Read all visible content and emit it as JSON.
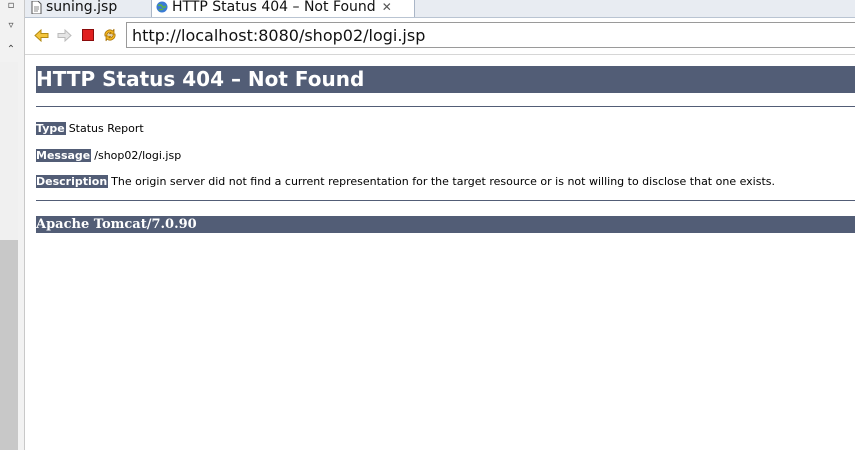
{
  "tabs": [
    {
      "label": "suning.jsp",
      "icon": "file-icon"
    },
    {
      "label": "HTTP Status 404 – Not Found",
      "icon": "globe-icon",
      "close": "✕"
    }
  ],
  "nav": {
    "back": "back-arrow-icon",
    "forward": "forward-arrow-icon",
    "stop": "stop-icon",
    "refresh": "refresh-icon",
    "url": "http://localhost:8080/shop02/logi.jsp"
  },
  "page": {
    "title": "HTTP Status 404 – Not Found",
    "type_label": "Type",
    "type_value": "Status Report",
    "message_label": "Message",
    "message_value": "/shop02/logi.jsp",
    "description_label": "Description",
    "description_value": "The origin server did not find a current representation for the target resource or is not willing to disclose that one exists.",
    "footer": "Apache Tomcat/7.0.90"
  },
  "colors": {
    "header_bg": "#525d76",
    "tab_bar_bg": "#e8ecf2"
  }
}
